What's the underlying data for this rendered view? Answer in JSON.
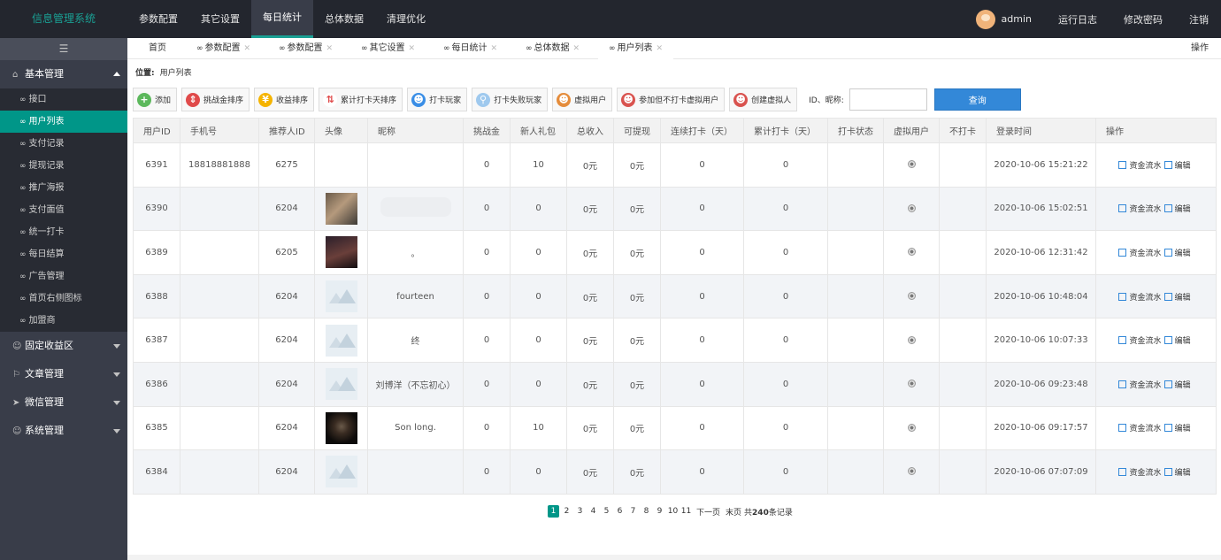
{
  "app": {
    "title": "信息管理系统"
  },
  "topnav": [
    {
      "label": "参数配置"
    },
    {
      "label": "其它设置"
    },
    {
      "label": "每日统计",
      "active": true
    },
    {
      "label": "总体数据"
    },
    {
      "label": "清理优化"
    }
  ],
  "user": {
    "name": "admin",
    "links": [
      "运行日志",
      "修改密码",
      "注销"
    ]
  },
  "sidebar": {
    "toggle_icon": "menu-icon",
    "groups": [
      {
        "label": "基本管理",
        "icon": "home-icon",
        "expanded": true,
        "items": [
          "接口",
          "用户列表",
          "支付记录",
          "提现记录",
          "推广海报",
          "支付面值",
          "统一打卡",
          "每日结算",
          "广告管理",
          "首页右侧图标",
          "加盟商"
        ]
      },
      {
        "label": "固定收益区",
        "icon": "user-icon"
      },
      {
        "label": "文章管理",
        "icon": "flag-icon"
      },
      {
        "label": "微信管理",
        "icon": "send-icon"
      },
      {
        "label": "系统管理",
        "icon": "user-icon"
      }
    ],
    "active_item": "用户列表"
  },
  "tabs": [
    {
      "label": "首页"
    },
    {
      "label": "参数配置"
    },
    {
      "label": "参数配置"
    },
    {
      "label": "其它设置"
    },
    {
      "label": "每日统计"
    },
    {
      "label": "总体数据"
    },
    {
      "label": "用户列表",
      "active": true
    }
  ],
  "tab_ops": "操作",
  "breadcrumb": {
    "label": "位置:",
    "value": "用户列表"
  },
  "toolbar": {
    "buttons": [
      "添加",
      "挑战金排序",
      "收益排序",
      "累计打卡天排序",
      "打卡玩家",
      "打卡失败玩家",
      "虚拟用户",
      "参加但不打卡虚拟用户",
      "创建虚拟人"
    ],
    "search_label": "ID、昵称:",
    "search_value": "",
    "query_label": "查询"
  },
  "table": {
    "headers": [
      "用户ID",
      "手机号",
      "推荐人ID",
      "头像",
      "昵称",
      "挑战金",
      "新人礼包",
      "总收入",
      "可提现",
      "连续打卡（天）",
      "累计打卡（天）",
      "打卡状态",
      "虚拟用户",
      "不打卡",
      "登录时间",
      "操作"
    ],
    "rows": [
      {
        "id": "6391",
        "phone": "18818881888",
        "ref": "6275",
        "avatar": "none",
        "nick": "",
        "challenge": "0",
        "gift": "10",
        "income": "0元",
        "withdraw": "0元",
        "streak": "0",
        "total": "0",
        "time": "2020-10-06 15:21:22"
      },
      {
        "id": "6390",
        "phone": "",
        "ref": "6204",
        "avatar": "photo1",
        "nick": "",
        "challenge": "0",
        "gift": "0",
        "income": "0元",
        "withdraw": "0元",
        "streak": "0",
        "total": "0",
        "time": "2020-10-06 15:02:51"
      },
      {
        "id": "6389",
        "phone": "",
        "ref": "6205",
        "avatar": "photo2",
        "nick": "。",
        "challenge": "0",
        "gift": "0",
        "income": "0元",
        "withdraw": "0元",
        "streak": "0",
        "total": "0",
        "time": "2020-10-06 12:31:42"
      },
      {
        "id": "6388",
        "phone": "",
        "ref": "6204",
        "avatar": "placeholder",
        "nick": "fourteen",
        "challenge": "0",
        "gift": "0",
        "income": "0元",
        "withdraw": "0元",
        "streak": "0",
        "total": "0",
        "time": "2020-10-06 10:48:04"
      },
      {
        "id": "6387",
        "phone": "",
        "ref": "6204",
        "avatar": "placeholder",
        "nick": "终",
        "challenge": "0",
        "gift": "0",
        "income": "0元",
        "withdraw": "0元",
        "streak": "0",
        "total": "0",
        "time": "2020-10-06 10:07:33"
      },
      {
        "id": "6386",
        "phone": "",
        "ref": "6204",
        "avatar": "placeholder",
        "nick": "刘博洋（不忘初心）",
        "challenge": "0",
        "gift": "0",
        "income": "0元",
        "withdraw": "0元",
        "streak": "0",
        "total": "0",
        "time": "2020-10-06 09:23:48"
      },
      {
        "id": "6385",
        "phone": "",
        "ref": "6204",
        "avatar": "photo3",
        "nick": "Son long.",
        "challenge": "0",
        "gift": "10",
        "income": "0元",
        "withdraw": "0元",
        "streak": "0",
        "total": "0",
        "time": "2020-10-06 09:17:57"
      },
      {
        "id": "6384",
        "phone": "",
        "ref": "6204",
        "avatar": "placeholder",
        "nick": "",
        "challenge": "0",
        "gift": "0",
        "income": "0元",
        "withdraw": "0元",
        "streak": "0",
        "total": "0",
        "time": "2020-10-06 07:07:09"
      }
    ],
    "op_flow": "资金流水",
    "op_edit": "编辑"
  },
  "pager": {
    "pages": [
      "1",
      "2",
      "3",
      "4",
      "5",
      "6",
      "7",
      "8",
      "9",
      "10",
      "11"
    ],
    "current": "1",
    "next": "下一页",
    "last": "末页",
    "total_prefix": "共",
    "total_count": "240",
    "total_suffix": "条记录"
  },
  "colors": {
    "accent": "#009688",
    "topbar": "#23262e",
    "sidebar": "#393d49",
    "query": "#3388d8"
  }
}
